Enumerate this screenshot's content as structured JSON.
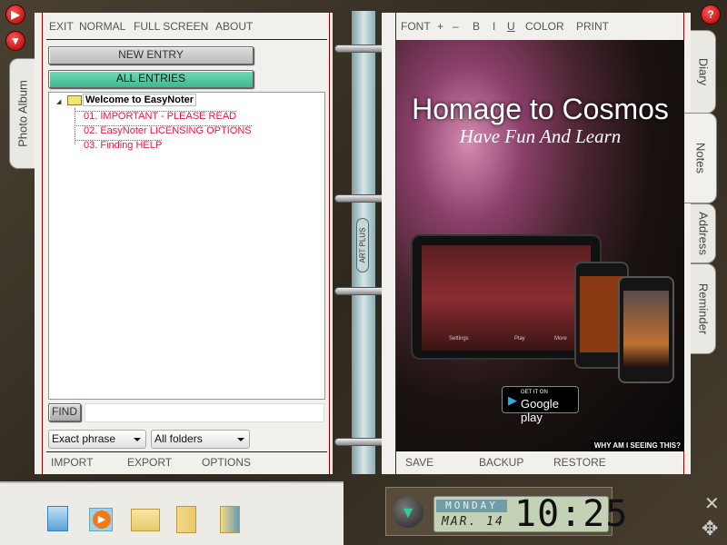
{
  "left_menu": [
    "EXIT",
    "NORMAL",
    "FULL SCREEN",
    "ABOUT"
  ],
  "buttons": {
    "new_entry": "NEW ENTRY",
    "all_entries": "ALL ENTRIES",
    "find": "FIND"
  },
  "tree": {
    "root": "Welcome to EasyNoter",
    "items": [
      "01. IMPORTANT - PLEASE READ",
      "02. EasyNoter LICENSING OPTIONS",
      "03. Finding HELP"
    ]
  },
  "search": {
    "value": "",
    "match_select": "Exact phrase",
    "folder_select": "All folders"
  },
  "left_bottom_menu": [
    "IMPORT",
    "EXPORT",
    "OPTIONS"
  ],
  "right_toolbar": [
    "FONT",
    "+",
    "–",
    "B",
    "I",
    "U",
    "COLOR",
    "PRINT"
  ],
  "ad": {
    "title": "Homage to Cosmos",
    "subtitle": "Have Fun And Learn",
    "badge_top": "GET IT ON",
    "badge_main": "Google play",
    "why": "WHY AM I SEEING THIS?",
    "tablet_labels": [
      "Settings",
      "Play",
      "More"
    ]
  },
  "right_bottom_menu": [
    "SAVE",
    "BACKUP",
    "RESTORE"
  ],
  "tabs": {
    "left": "Photo Album",
    "right": [
      "Diary",
      "Notes",
      "Address",
      "Reminder"
    ],
    "active": "Notes"
  },
  "spine_label": "ART PLUS",
  "clock": {
    "day": "MONDAY",
    "date": "MAR. 14",
    "time": "10:25"
  },
  "dock_icons": [
    "calculator-icon",
    "media-player-icon",
    "network-folder-icon",
    "documents-folder-icon",
    "pictures-folder-icon"
  ],
  "colors": {
    "accent_green": "#4cc9a4",
    "entry_red": "#f0143c",
    "page": "#f1f0ec",
    "lcd": "#c3d2b4"
  }
}
